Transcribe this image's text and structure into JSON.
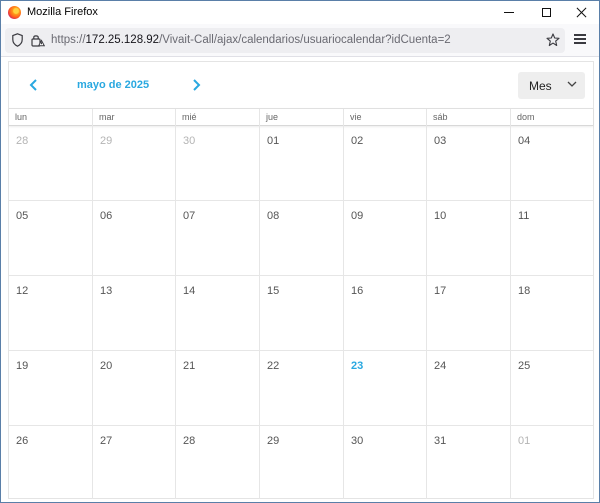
{
  "window": {
    "title": "Mozilla Firefox"
  },
  "urlbar": {
    "prefix": "https://",
    "host": "172.25.128.92",
    "path": "/Vivait-Call/ajax/calendarios/usuariocalendar?idCuenta=2"
  },
  "calendar": {
    "month_title": "mayo de 2025",
    "view_select": "Mes",
    "weekdays": [
      "lun",
      "mar",
      "mié",
      "jue",
      "vie",
      "sáb",
      "dom"
    ],
    "weeks": [
      [
        {
          "d": "28",
          "other": true
        },
        {
          "d": "29",
          "other": true
        },
        {
          "d": "30",
          "other": true
        },
        {
          "d": "01"
        },
        {
          "d": "02"
        },
        {
          "d": "03"
        },
        {
          "d": "04"
        }
      ],
      [
        {
          "d": "05"
        },
        {
          "d": "06"
        },
        {
          "d": "07"
        },
        {
          "d": "08"
        },
        {
          "d": "09"
        },
        {
          "d": "10"
        },
        {
          "d": "11"
        }
      ],
      [
        {
          "d": "12"
        },
        {
          "d": "13"
        },
        {
          "d": "14"
        },
        {
          "d": "15"
        },
        {
          "d": "16"
        },
        {
          "d": "17"
        },
        {
          "d": "18"
        }
      ],
      [
        {
          "d": "19"
        },
        {
          "d": "20"
        },
        {
          "d": "21"
        },
        {
          "d": "22"
        },
        {
          "d": "23",
          "today": true
        },
        {
          "d": "24"
        },
        {
          "d": "25"
        }
      ],
      [
        {
          "d": "26"
        },
        {
          "d": "27"
        },
        {
          "d": "28"
        },
        {
          "d": "29"
        },
        {
          "d": "30"
        },
        {
          "d": "31"
        },
        {
          "d": "01",
          "other": true
        }
      ]
    ],
    "accent_color": "#29a8e0"
  },
  "icons": {
    "app": "firefox-logo-icon",
    "tracking": "shield-icon",
    "security": "lock-warning-icon",
    "bookmark": "star-icon",
    "menu": "hamburger-menu-icon",
    "prev": "chevron-left-icon",
    "next": "chevron-right-icon",
    "dropdown": "chevron-down-icon"
  }
}
